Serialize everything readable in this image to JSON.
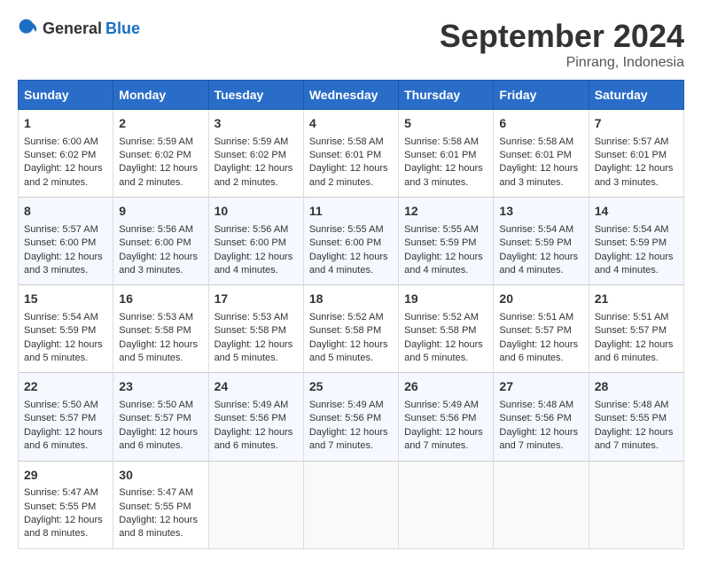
{
  "logo": {
    "general": "General",
    "blue": "Blue"
  },
  "header": {
    "month": "September 2024",
    "location": "Pinrang, Indonesia"
  },
  "weekdays": [
    "Sunday",
    "Monday",
    "Tuesday",
    "Wednesday",
    "Thursday",
    "Friday",
    "Saturday"
  ],
  "weeks": [
    [
      {
        "day": "1",
        "sunrise": "Sunrise: 6:00 AM",
        "sunset": "Sunset: 6:02 PM",
        "daylight": "Daylight: 12 hours and 2 minutes."
      },
      {
        "day": "2",
        "sunrise": "Sunrise: 5:59 AM",
        "sunset": "Sunset: 6:02 PM",
        "daylight": "Daylight: 12 hours and 2 minutes."
      },
      {
        "day": "3",
        "sunrise": "Sunrise: 5:59 AM",
        "sunset": "Sunset: 6:02 PM",
        "daylight": "Daylight: 12 hours and 2 minutes."
      },
      {
        "day": "4",
        "sunrise": "Sunrise: 5:58 AM",
        "sunset": "Sunset: 6:01 PM",
        "daylight": "Daylight: 12 hours and 2 minutes."
      },
      {
        "day": "5",
        "sunrise": "Sunrise: 5:58 AM",
        "sunset": "Sunset: 6:01 PM",
        "daylight": "Daylight: 12 hours and 3 minutes."
      },
      {
        "day": "6",
        "sunrise": "Sunrise: 5:58 AM",
        "sunset": "Sunset: 6:01 PM",
        "daylight": "Daylight: 12 hours and 3 minutes."
      },
      {
        "day": "7",
        "sunrise": "Sunrise: 5:57 AM",
        "sunset": "Sunset: 6:01 PM",
        "daylight": "Daylight: 12 hours and 3 minutes."
      }
    ],
    [
      {
        "day": "8",
        "sunrise": "Sunrise: 5:57 AM",
        "sunset": "Sunset: 6:00 PM",
        "daylight": "Daylight: 12 hours and 3 minutes."
      },
      {
        "day": "9",
        "sunrise": "Sunrise: 5:56 AM",
        "sunset": "Sunset: 6:00 PM",
        "daylight": "Daylight: 12 hours and 3 minutes."
      },
      {
        "day": "10",
        "sunrise": "Sunrise: 5:56 AM",
        "sunset": "Sunset: 6:00 PM",
        "daylight": "Daylight: 12 hours and 4 minutes."
      },
      {
        "day": "11",
        "sunrise": "Sunrise: 5:55 AM",
        "sunset": "Sunset: 6:00 PM",
        "daylight": "Daylight: 12 hours and 4 minutes."
      },
      {
        "day": "12",
        "sunrise": "Sunrise: 5:55 AM",
        "sunset": "Sunset: 5:59 PM",
        "daylight": "Daylight: 12 hours and 4 minutes."
      },
      {
        "day": "13",
        "sunrise": "Sunrise: 5:54 AM",
        "sunset": "Sunset: 5:59 PM",
        "daylight": "Daylight: 12 hours and 4 minutes."
      },
      {
        "day": "14",
        "sunrise": "Sunrise: 5:54 AM",
        "sunset": "Sunset: 5:59 PM",
        "daylight": "Daylight: 12 hours and 4 minutes."
      }
    ],
    [
      {
        "day": "15",
        "sunrise": "Sunrise: 5:54 AM",
        "sunset": "Sunset: 5:59 PM",
        "daylight": "Daylight: 12 hours and 5 minutes."
      },
      {
        "day": "16",
        "sunrise": "Sunrise: 5:53 AM",
        "sunset": "Sunset: 5:58 PM",
        "daylight": "Daylight: 12 hours and 5 minutes."
      },
      {
        "day": "17",
        "sunrise": "Sunrise: 5:53 AM",
        "sunset": "Sunset: 5:58 PM",
        "daylight": "Daylight: 12 hours and 5 minutes."
      },
      {
        "day": "18",
        "sunrise": "Sunrise: 5:52 AM",
        "sunset": "Sunset: 5:58 PM",
        "daylight": "Daylight: 12 hours and 5 minutes."
      },
      {
        "day": "19",
        "sunrise": "Sunrise: 5:52 AM",
        "sunset": "Sunset: 5:58 PM",
        "daylight": "Daylight: 12 hours and 5 minutes."
      },
      {
        "day": "20",
        "sunrise": "Sunrise: 5:51 AM",
        "sunset": "Sunset: 5:57 PM",
        "daylight": "Daylight: 12 hours and 6 minutes."
      },
      {
        "day": "21",
        "sunrise": "Sunrise: 5:51 AM",
        "sunset": "Sunset: 5:57 PM",
        "daylight": "Daylight: 12 hours and 6 minutes."
      }
    ],
    [
      {
        "day": "22",
        "sunrise": "Sunrise: 5:50 AM",
        "sunset": "Sunset: 5:57 PM",
        "daylight": "Daylight: 12 hours and 6 minutes."
      },
      {
        "day": "23",
        "sunrise": "Sunrise: 5:50 AM",
        "sunset": "Sunset: 5:57 PM",
        "daylight": "Daylight: 12 hours and 6 minutes."
      },
      {
        "day": "24",
        "sunrise": "Sunrise: 5:49 AM",
        "sunset": "Sunset: 5:56 PM",
        "daylight": "Daylight: 12 hours and 6 minutes."
      },
      {
        "day": "25",
        "sunrise": "Sunrise: 5:49 AM",
        "sunset": "Sunset: 5:56 PM",
        "daylight": "Daylight: 12 hours and 7 minutes."
      },
      {
        "day": "26",
        "sunrise": "Sunrise: 5:49 AM",
        "sunset": "Sunset: 5:56 PM",
        "daylight": "Daylight: 12 hours and 7 minutes."
      },
      {
        "day": "27",
        "sunrise": "Sunrise: 5:48 AM",
        "sunset": "Sunset: 5:56 PM",
        "daylight": "Daylight: 12 hours and 7 minutes."
      },
      {
        "day": "28",
        "sunrise": "Sunrise: 5:48 AM",
        "sunset": "Sunset: 5:55 PM",
        "daylight": "Daylight: 12 hours and 7 minutes."
      }
    ],
    [
      {
        "day": "29",
        "sunrise": "Sunrise: 5:47 AM",
        "sunset": "Sunset: 5:55 PM",
        "daylight": "Daylight: 12 hours and 8 minutes."
      },
      {
        "day": "30",
        "sunrise": "Sunrise: 5:47 AM",
        "sunset": "Sunset: 5:55 PM",
        "daylight": "Daylight: 12 hours and 8 minutes."
      },
      {
        "day": "",
        "sunrise": "",
        "sunset": "",
        "daylight": ""
      },
      {
        "day": "",
        "sunrise": "",
        "sunset": "",
        "daylight": ""
      },
      {
        "day": "",
        "sunrise": "",
        "sunset": "",
        "daylight": ""
      },
      {
        "day": "",
        "sunrise": "",
        "sunset": "",
        "daylight": ""
      },
      {
        "day": "",
        "sunrise": "",
        "sunset": "",
        "daylight": ""
      }
    ]
  ]
}
